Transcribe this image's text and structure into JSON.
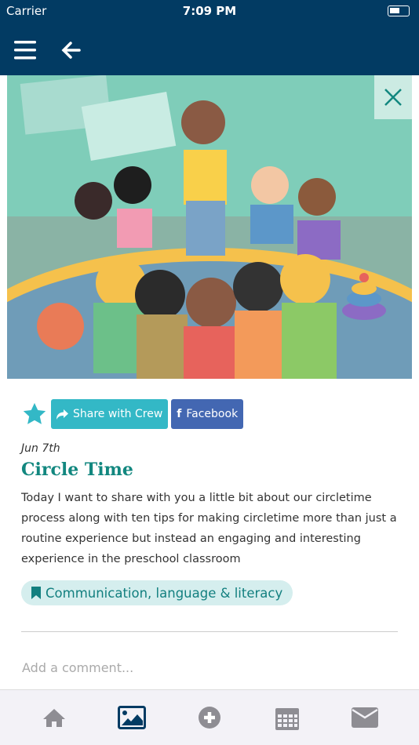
{
  "status_bar": {
    "carrier": "Carrier",
    "time": "7:09 PM"
  },
  "post": {
    "share_label": "Share with Crew",
    "facebook_label": "Facebook",
    "date": "Jun 7th",
    "title": "Circle Time",
    "description": "Today I want to share with you a little bit about our circletime process along with ten tips for making circletime more than just a routine experience but instead an engaging and interesting experience in the preschool classroom",
    "tag": "Communication, language & literacy"
  },
  "comment": {
    "placeholder": "Add a comment..."
  },
  "colors": {
    "nav": "#023b63",
    "share": "#33b8c6",
    "facebook": "#4367b2",
    "title": "#12877f",
    "tab_active": "#023b63",
    "tab_inactive": "#8e8d93"
  },
  "tabs": [
    {
      "icon": "home-icon"
    },
    {
      "icon": "image-icon",
      "active": true
    },
    {
      "icon": "plus-circle-icon"
    },
    {
      "icon": "calendar-icon"
    },
    {
      "icon": "mail-icon"
    }
  ]
}
